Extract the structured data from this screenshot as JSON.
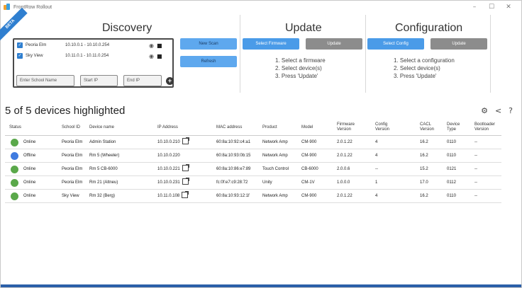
{
  "window": {
    "title": "FrontRow Rollout",
    "minimize": "–",
    "maximize": "☐",
    "close": "✕"
  },
  "beta": "BETA",
  "discovery": {
    "title": "Discovery",
    "ranges": [
      {
        "name": "Peoria Elm",
        "range": "10.10.0.1 - 10.10.0.254"
      },
      {
        "name": "Sky View",
        "range": "10.11.0.1 - 10.11.0.254"
      }
    ],
    "school_placeholder": "Enter School Name",
    "start_placeholder": "Start IP",
    "end_placeholder": "End IP",
    "new_scan": "New Scan",
    "refresh": "Refresh"
  },
  "update": {
    "title": "Update",
    "select_btn": "Select Firmware",
    "update_btn": "Update",
    "steps": [
      "1. Select a firmware",
      "2. Select device(s)",
      "3. Press 'Update'"
    ]
  },
  "configuration": {
    "title": "Configuration",
    "select_btn": "Select Config",
    "update_btn": "Update",
    "steps": [
      "1. Select a configuration",
      "2. Select device(s)",
      "3. Press 'Update'"
    ]
  },
  "devices": {
    "summary": "5 of 5 devices highlighted",
    "tools": {
      "settings": "⚙",
      "share": "<",
      "help": "?"
    },
    "columns": [
      "Status",
      "School ID",
      "Device name",
      "IP Address",
      "MAC address",
      "Product",
      "Model",
      "Firmware Version",
      "Config Version",
      "CACL Version",
      "Device Type",
      "Bootloader Version"
    ],
    "rows": [
      {
        "status": "Online",
        "color": "#5aa84a",
        "school": "Peoria Elm",
        "name": "Admin Station",
        "ip": "10.10.0.210",
        "link": true,
        "mac": "60:8a:10:92:c4:a1",
        "product": "Network Amp",
        "model": "CM-900",
        "fw": "2.0.1.22",
        "config": "4",
        "cacl": "16.2",
        "type": "0110",
        "boot": "--"
      },
      {
        "status": "Offline",
        "color": "#3f7be0",
        "school": "Peoria Elm",
        "name": "Rm 5 (Wheeler)",
        "ip": "10.10.0.220",
        "link": false,
        "mac": "60:8a:10:93:0b:15",
        "product": "Network Amp",
        "model": "CM-900",
        "fw": "2.0.1.22",
        "config": "4",
        "cacl": "16.2",
        "type": "0110",
        "boot": "--"
      },
      {
        "status": "Online",
        "color": "#5aa84a",
        "school": "Peoria Elm",
        "name": "Rm 5 CB-6000",
        "ip": "10.10.0.221",
        "link": true,
        "mac": "60:8a:10:86:e7:89",
        "product": "Touch Control",
        "model": "CB-6000",
        "fw": "2.0.0.6",
        "config": "--",
        "cacl": "15.2",
        "type": "0121",
        "boot": "--"
      },
      {
        "status": "Online",
        "color": "#5aa84a",
        "school": "Peoria Elm",
        "name": "Rm 21 (Altneu)",
        "ip": "10.10.0.231",
        "link": true,
        "mac": "fc:0f:e7:c9:28:72",
        "product": "Unity",
        "model": "CM-1V",
        "fw": "1.0.0.0",
        "config": "1",
        "cacl": "17.0",
        "type": "0112",
        "boot": "--"
      },
      {
        "status": "Online",
        "color": "#5aa84a",
        "school": "Sky View",
        "name": "Rm 32 (Berg)",
        "ip": "10.11.0.108",
        "link": true,
        "mac": "60:8a:10:93:12:1f",
        "product": "Network Amp",
        "model": "CM-900",
        "fw": "2.0.1.22",
        "config": "4",
        "cacl": "16.2",
        "type": "0110",
        "boot": "--"
      }
    ]
  }
}
